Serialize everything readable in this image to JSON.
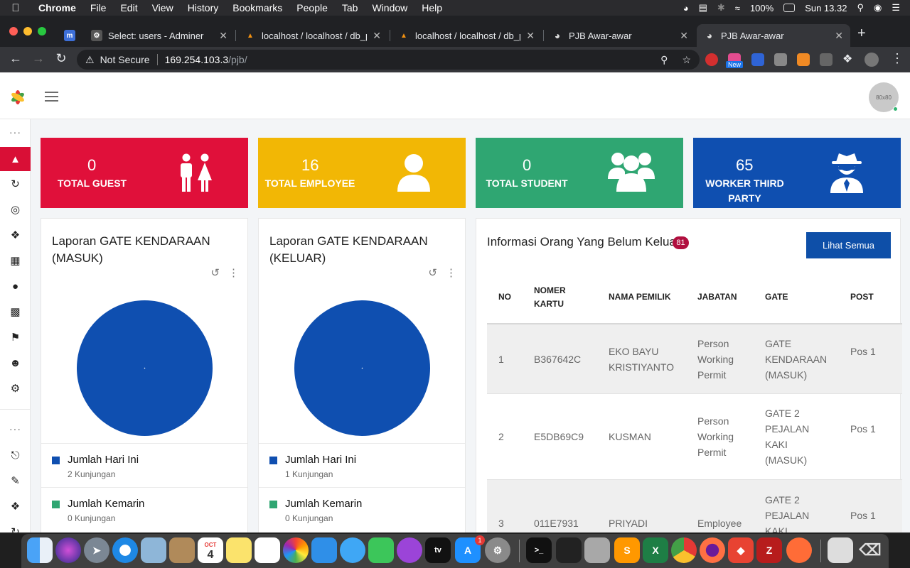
{
  "menubar": {
    "app": "Chrome",
    "items": [
      "File",
      "Edit",
      "View",
      "History",
      "Bookmarks",
      "People",
      "Tab",
      "Window",
      "Help"
    ],
    "battery": "100%",
    "clock": "Sun 13.32"
  },
  "tabs": [
    {
      "title": "Select: users - Adminer"
    },
    {
      "title": "localhost / localhost / db_p"
    },
    {
      "title": "localhost / localhost / db_p"
    },
    {
      "title": "PJB Awar-awar"
    },
    {
      "title": "PJB Awar-awar"
    }
  ],
  "address": {
    "security": "Not Secure",
    "host": "169.254.103.3",
    "path": "/pjb/"
  },
  "extension_badge": "New",
  "avatar_text": "80x80",
  "stats": [
    {
      "value": "0",
      "label": "TOTAL GUEST",
      "color": "#e0103a",
      "icon": "guest-couple-icon"
    },
    {
      "value": "16",
      "label": "TOTAL EMPLOYEE",
      "color": "#f2b705",
      "icon": "user-icon"
    },
    {
      "value": "0",
      "label": "TOTAL STUDENT",
      "color": "#2fa672",
      "icon": "users-group-icon"
    },
    {
      "value": "65",
      "label": "WORKER THIRD PARTY",
      "color": "#0f4fb0",
      "icon": "user-secret-icon"
    }
  ],
  "reports": [
    {
      "title": "Laporan GATE KENDARAAN (MASUK)",
      "chart_data": {
        "type": "pie",
        "labels": [
          "Jumlah Hari Ini",
          "Jumlah Kemarin"
        ],
        "values": [
          2,
          0
        ],
        "colors": [
          "#0f4fb0",
          "#2fa672"
        ]
      },
      "legend": [
        {
          "name": "Jumlah Hari Ini",
          "value": "2 Kunjungan",
          "color": "#0f4fb0"
        },
        {
          "name": "Jumlah Kemarin",
          "value": "0 Kunjungan",
          "color": "#2fa672"
        }
      ]
    },
    {
      "title": "Laporan GATE KENDARAAN (KELUAR)",
      "chart_data": {
        "type": "pie",
        "labels": [
          "Jumlah Hari Ini",
          "Jumlah Kemarin"
        ],
        "values": [
          1,
          0
        ],
        "colors": [
          "#0f4fb0",
          "#2fa672"
        ]
      },
      "legend": [
        {
          "name": "Jumlah Hari Ini",
          "value": "1 Kunjungan",
          "color": "#0f4fb0"
        },
        {
          "name": "Jumlah Kemarin",
          "value": "0 Kunjungan",
          "color": "#2fa672"
        }
      ]
    }
  ],
  "info": {
    "title": "Informasi Orang Yang Belum Keluar",
    "count": "81",
    "button": "Lihat Semua",
    "columns": [
      "NO",
      "NOMER KARTU",
      "NAMA PEMILIK",
      "JABATAN",
      "GATE",
      "POST"
    ],
    "rows": [
      [
        "1",
        "B367642C",
        "EKO BAYU KRISTIYANTO",
        "Person Working Permit",
        "GATE KENDARAAN (MASUK)",
        "Pos 1"
      ],
      [
        "2",
        "E5DB69C9",
        "KUSMAN",
        "Person Working Permit",
        "GATE 2 PEJALAN KAKI (MASUK)",
        "Pos 1"
      ],
      [
        "3",
        "011E7931",
        "PRIYADI",
        "Employee",
        "GATE 2 PEJALAN KAKI",
        "Pos 1"
      ]
    ]
  },
  "dock": {
    "calendar_month": "OCT",
    "calendar_day": "4",
    "appstore_badge": "1"
  }
}
